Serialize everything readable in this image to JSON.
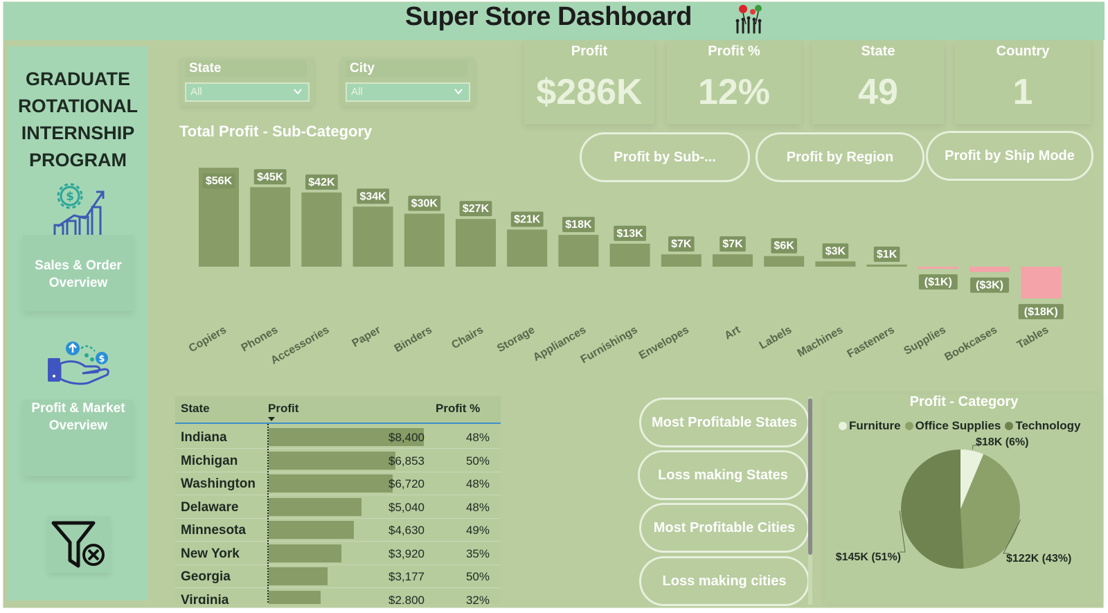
{
  "header": {
    "title": "Super Store Dashboard",
    "logo_icon": "people-balloons-icon"
  },
  "sidebar": {
    "program_lines": [
      "GRADUATE",
      "ROTATIONAL",
      "INTERNSHIP",
      "PROGRAM"
    ],
    "nav": [
      {
        "label_lines": [
          "Sales & Order",
          "Overview"
        ],
        "icon": "dollar-gear-growth-chart-icon"
      },
      {
        "label_lines": [
          "Profit & Market",
          "Overview"
        ],
        "icon": "hand-money-icon"
      }
    ],
    "clear_filter_icon": "clear-filter-icon"
  },
  "slicers": [
    {
      "label": "State",
      "value": "All"
    },
    {
      "label": "City",
      "value": "All"
    }
  ],
  "kpis": [
    {
      "label": "Profit",
      "value": "$286K"
    },
    {
      "label": "Profit %",
      "value": "12%"
    },
    {
      "label": "State",
      "value": "49"
    },
    {
      "label": "Country",
      "value": "1"
    }
  ],
  "nav_buttons": [
    "Profit by Sub-...",
    "Profit by Region",
    "Profit by Ship Mode"
  ],
  "filter_buttons": [
    "Most Profitable States",
    "Loss making States",
    "Most Profitable Cities",
    "Loss making cities"
  ],
  "chart_data": [
    {
      "type": "bar",
      "title": "Total Profit - Sub-Category",
      "categories": [
        "Copiers",
        "Phones",
        "Accessories",
        "Paper",
        "Binders",
        "Chairs",
        "Storage",
        "Appliances",
        "Furnishings",
        "Envelopes",
        "Art",
        "Labels",
        "Machines",
        "Fasteners",
        "Supplies",
        "Bookcases",
        "Tables"
      ],
      "values": [
        56,
        45,
        42,
        34,
        30,
        27,
        21,
        18,
        13,
        7,
        7,
        6,
        3,
        1,
        -1,
        -3,
        -18
      ],
      "value_labels": [
        "$56K",
        "$45K",
        "$42K",
        "$34K",
        "$30K",
        "$27K",
        "$21K",
        "$18K",
        "$13K",
        "$7K",
        "$7K",
        "$6K",
        "$3K",
        "$1K",
        "($1K)",
        "($3K)",
        "($18K)"
      ],
      "unit": "K USD",
      "colors": {
        "positive": "#879c66",
        "negative": "#f4a3a8",
        "label_bg": "#7e9460"
      }
    },
    {
      "type": "pie",
      "title": "Profit - Category",
      "categories": [
        "Furniture",
        "Office Supplies",
        "Technology"
      ],
      "values": [
        18,
        122,
        145
      ],
      "percents": [
        6,
        43,
        51
      ],
      "value_labels": [
        "$18K (6%)",
        "$122K (43%)",
        "$145K (51%)"
      ],
      "colors": [
        "#e9f2dd",
        "#8ca06a",
        "#6f8350"
      ],
      "legend": "top"
    }
  ],
  "state_table": {
    "columns": [
      "State",
      "Profit",
      "Profit %"
    ],
    "sorted_by": "Profit",
    "rows": [
      {
        "state": "Indiana",
        "profit": "$8,400",
        "profit_value": 8400,
        "pct": "48%"
      },
      {
        "state": "Michigan",
        "profit": "$6,853",
        "profit_value": 6853,
        "pct": "50%"
      },
      {
        "state": "Washington",
        "profit": "$6,720",
        "profit_value": 6720,
        "pct": "48%"
      },
      {
        "state": "Delaware",
        "profit": "$5,040",
        "profit_value": 5040,
        "pct": "48%"
      },
      {
        "state": "Minnesota",
        "profit": "$4,630",
        "profit_value": 4630,
        "pct": "49%"
      },
      {
        "state": "New York",
        "profit": "$3,920",
        "profit_value": 3920,
        "pct": "35%"
      },
      {
        "state": "Georgia",
        "profit": "$3,177",
        "profit_value": 3177,
        "pct": "50%"
      },
      {
        "state": "Virginia",
        "profit": "$2,800",
        "profit_value": 2800,
        "pct": "32%"
      }
    ]
  }
}
